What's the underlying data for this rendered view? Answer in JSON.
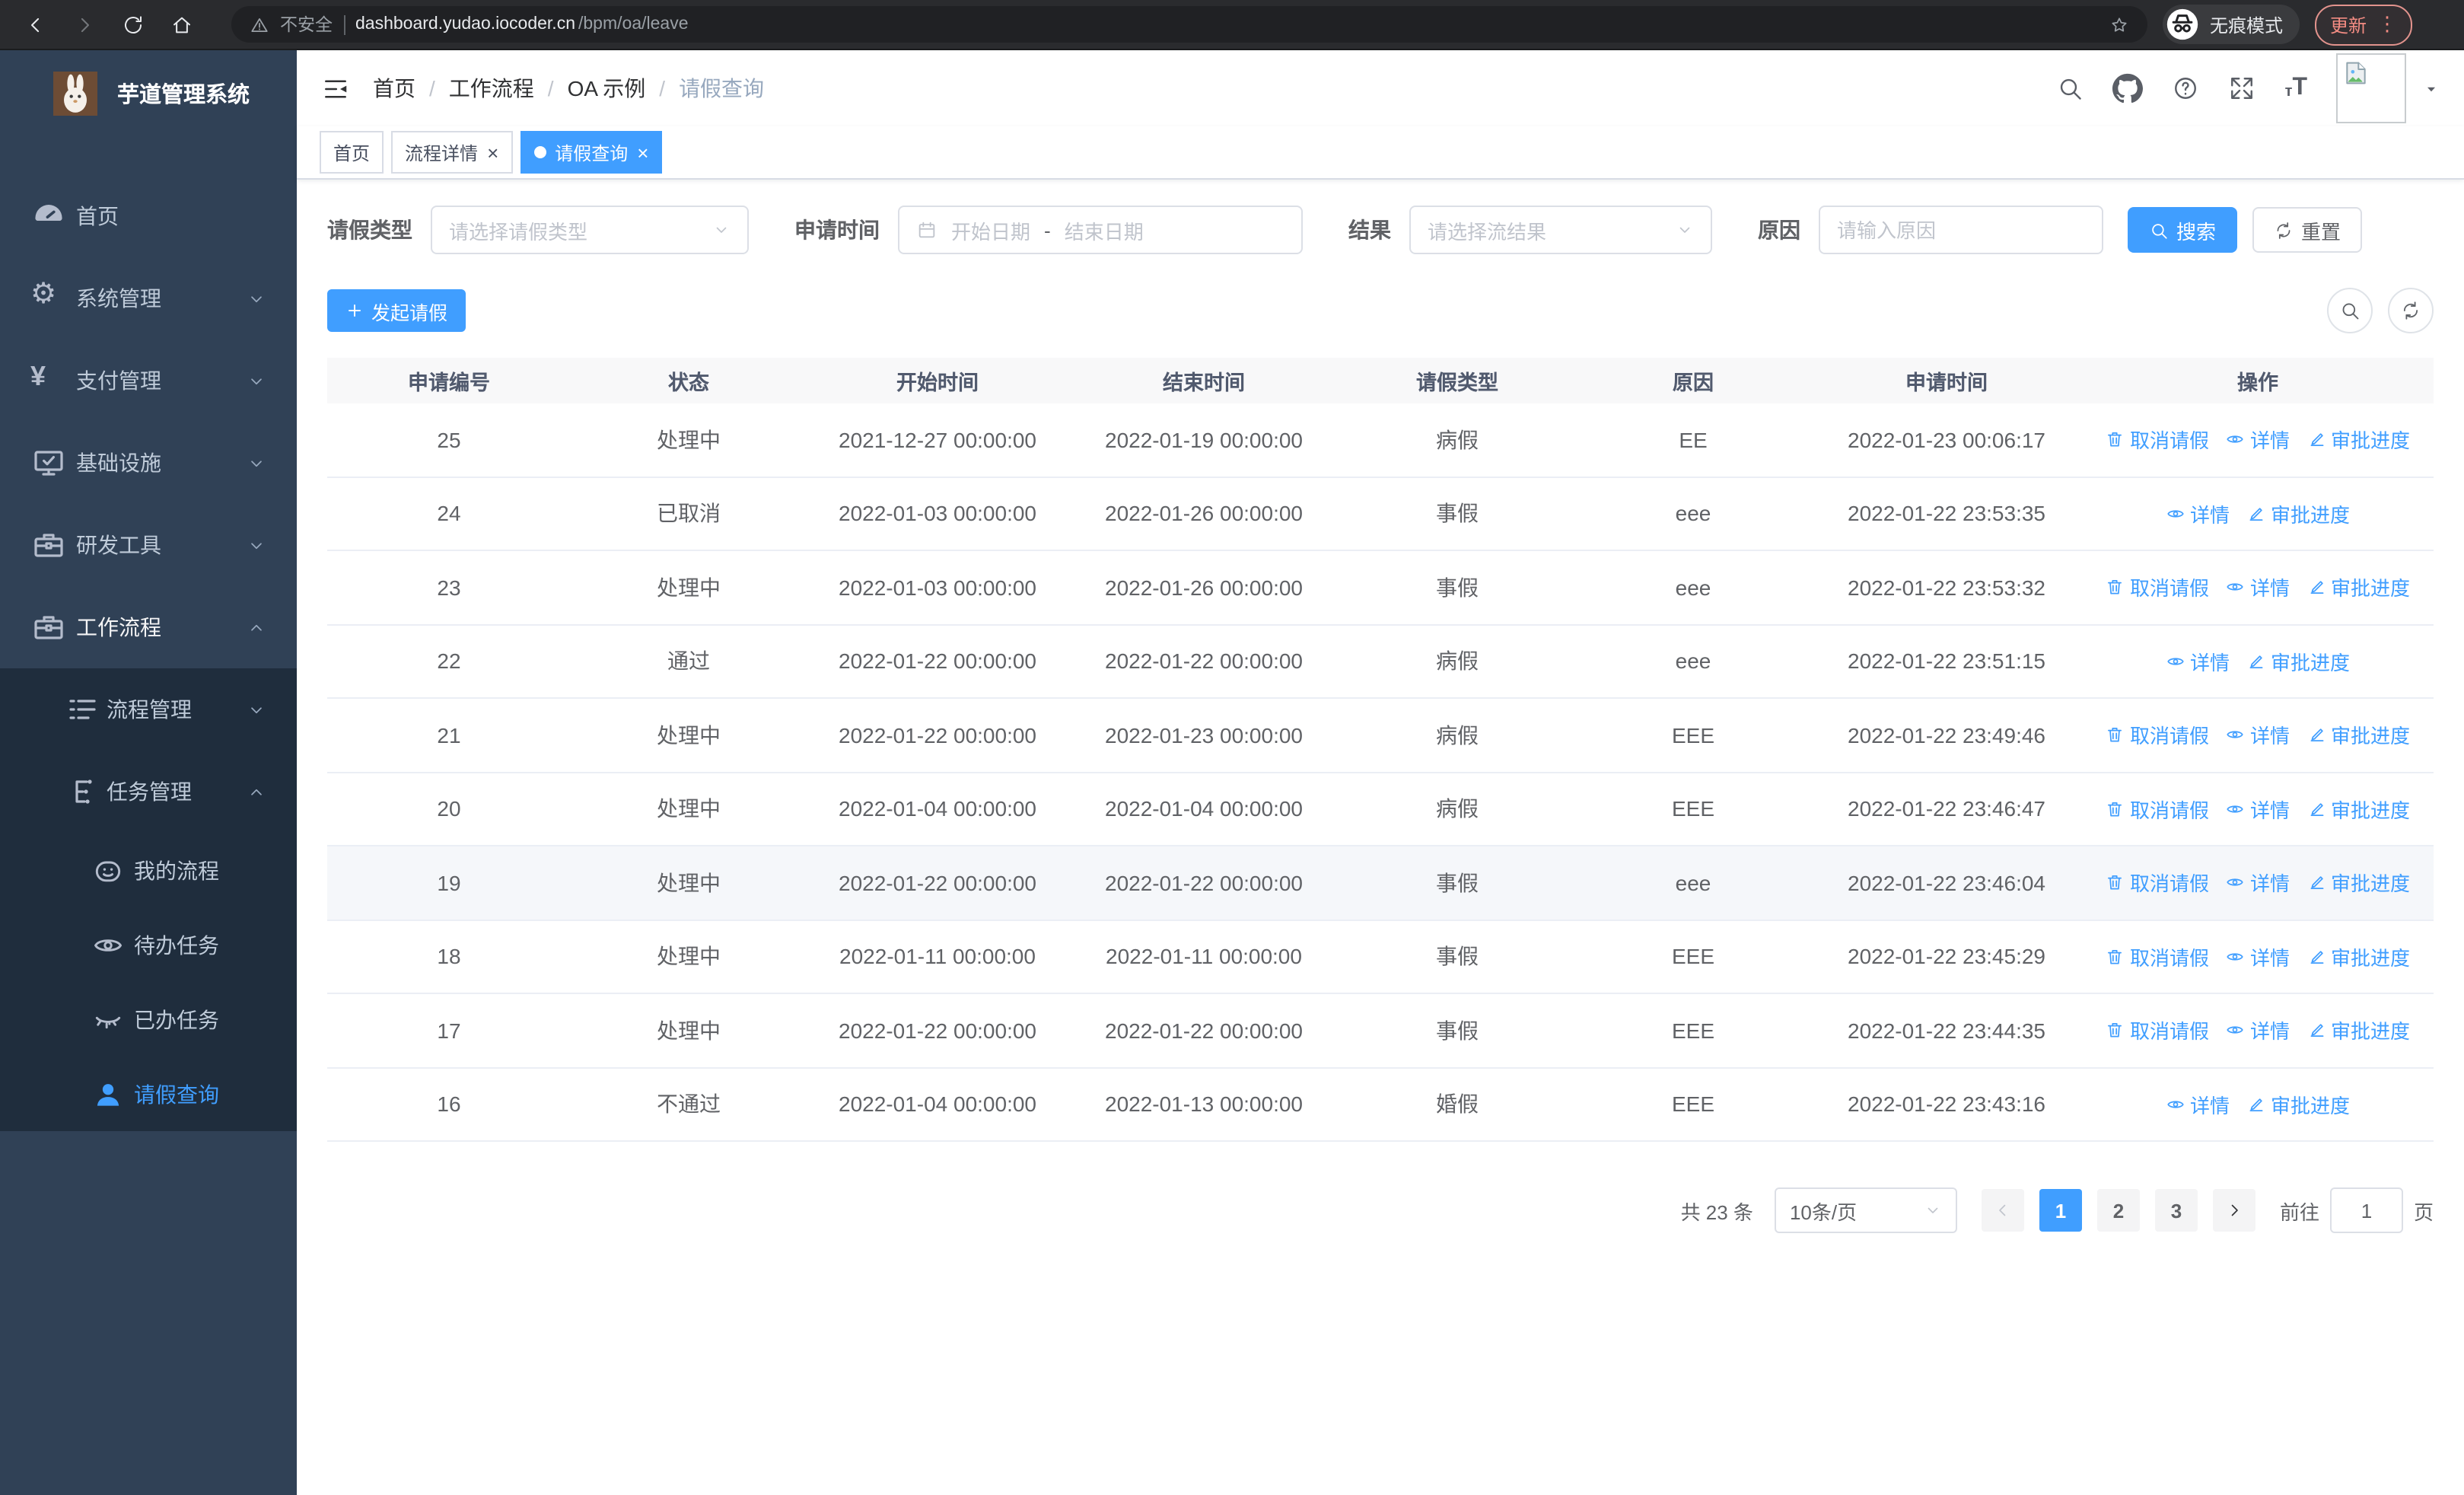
{
  "browser": {
    "security_warning": "不安全",
    "url_host": "dashboard.yudao.iocoder.cn",
    "url_path": "/bpm/oa/leave",
    "incognito_label": "无痕模式",
    "update_button": "更新"
  },
  "sidebar": {
    "app_title": "芋道管理系统",
    "items": [
      {
        "label": "首页",
        "icon": "dashboard-icon"
      },
      {
        "label": "系统管理",
        "icon": "gear-icon"
      },
      {
        "label": "支付管理",
        "icon": "yen-icon"
      },
      {
        "label": "基础设施",
        "icon": "monitor-icon"
      },
      {
        "label": "研发工具",
        "icon": "toolbox-icon"
      },
      {
        "label": "工作流程",
        "icon": "briefcase-icon"
      },
      {
        "label": "流程管理",
        "icon": "list-icon"
      },
      {
        "label": "任务管理",
        "icon": "org-icon"
      },
      {
        "label": "我的流程",
        "icon": "face-icon"
      },
      {
        "label": "待办任务",
        "icon": "eye-icon"
      },
      {
        "label": "已办任务",
        "icon": "eye-closed-icon"
      },
      {
        "label": "请假查询",
        "icon": "user-icon"
      }
    ]
  },
  "breadcrumb": {
    "separator": "/",
    "items": [
      "首页",
      "工作流程",
      "OA 示例",
      "请假查询"
    ]
  },
  "tabs": [
    {
      "label": "首页"
    },
    {
      "label": "流程详情"
    },
    {
      "label": "请假查询"
    }
  ],
  "filters": {
    "leave_type": {
      "label": "请假类型",
      "placeholder": "请选择请假类型"
    },
    "apply_time": {
      "label": "申请时间",
      "start_placeholder": "开始日期",
      "separator": "-",
      "end_placeholder": "结束日期"
    },
    "result": {
      "label": "结果",
      "placeholder": "请选择流结果"
    },
    "reason": {
      "label": "原因",
      "placeholder": "请输入原因"
    },
    "search_button": "搜索",
    "reset_button": "重置"
  },
  "toolbar": {
    "create_button": "发起请假"
  },
  "table": {
    "columns": [
      "申请编号",
      "状态",
      "开始时间",
      "结束时间",
      "请假类型",
      "原因",
      "申请时间",
      "操作"
    ],
    "rows": [
      {
        "id": "25",
        "status": "处理中",
        "start": "2021-12-27 00:00:00",
        "end": "2022-01-19 00:00:00",
        "type": "病假",
        "reason": "EE",
        "apply": "2022-01-23 00:06:17",
        "highlight": false,
        "actions": [
          {
            "label": "取消请假",
            "icon": "delete"
          },
          {
            "label": "详情",
            "icon": "view"
          },
          {
            "label": "审批进度",
            "icon": "edit"
          }
        ]
      },
      {
        "id": "24",
        "status": "已取消",
        "start": "2022-01-03 00:00:00",
        "end": "2022-01-26 00:00:00",
        "type": "事假",
        "reason": "eee",
        "apply": "2022-01-22 23:53:35",
        "highlight": false,
        "actions": [
          {
            "label": "详情",
            "icon": "view"
          },
          {
            "label": "审批进度",
            "icon": "edit"
          }
        ]
      },
      {
        "id": "23",
        "status": "处理中",
        "start": "2022-01-03 00:00:00",
        "end": "2022-01-26 00:00:00",
        "type": "事假",
        "reason": "eee",
        "apply": "2022-01-22 23:53:32",
        "highlight": false,
        "actions": [
          {
            "label": "取消请假",
            "icon": "delete"
          },
          {
            "label": "详情",
            "icon": "view"
          },
          {
            "label": "审批进度",
            "icon": "edit"
          }
        ]
      },
      {
        "id": "22",
        "status": "通过",
        "start": "2022-01-22 00:00:00",
        "end": "2022-01-22 00:00:00",
        "type": "病假",
        "reason": "eee",
        "apply": "2022-01-22 23:51:15",
        "highlight": false,
        "actions": [
          {
            "label": "详情",
            "icon": "view"
          },
          {
            "label": "审批进度",
            "icon": "edit"
          }
        ]
      },
      {
        "id": "21",
        "status": "处理中",
        "start": "2022-01-22 00:00:00",
        "end": "2022-01-23 00:00:00",
        "type": "病假",
        "reason": "EEE",
        "apply": "2022-01-22 23:49:46",
        "highlight": false,
        "actions": [
          {
            "label": "取消请假",
            "icon": "delete"
          },
          {
            "label": "详情",
            "icon": "view"
          },
          {
            "label": "审批进度",
            "icon": "edit"
          }
        ]
      },
      {
        "id": "20",
        "status": "处理中",
        "start": "2022-01-04 00:00:00",
        "end": "2022-01-04 00:00:00",
        "type": "病假",
        "reason": "EEE",
        "apply": "2022-01-22 23:46:47",
        "highlight": false,
        "actions": [
          {
            "label": "取消请假",
            "icon": "delete"
          },
          {
            "label": "详情",
            "icon": "view"
          },
          {
            "label": "审批进度",
            "icon": "edit"
          }
        ]
      },
      {
        "id": "19",
        "status": "处理中",
        "start": "2022-01-22 00:00:00",
        "end": "2022-01-22 00:00:00",
        "type": "事假",
        "reason": "eee",
        "apply": "2022-01-22 23:46:04",
        "highlight": true,
        "actions": [
          {
            "label": "取消请假",
            "icon": "delete"
          },
          {
            "label": "详情",
            "icon": "view"
          },
          {
            "label": "审批进度",
            "icon": "edit"
          }
        ]
      },
      {
        "id": "18",
        "status": "处理中",
        "start": "2022-01-11 00:00:00",
        "end": "2022-01-11 00:00:00",
        "type": "事假",
        "reason": "EEE",
        "apply": "2022-01-22 23:45:29",
        "highlight": false,
        "actions": [
          {
            "label": "取消请假",
            "icon": "delete"
          },
          {
            "label": "详情",
            "icon": "view"
          },
          {
            "label": "审批进度",
            "icon": "edit"
          }
        ]
      },
      {
        "id": "17",
        "status": "处理中",
        "start": "2022-01-22 00:00:00",
        "end": "2022-01-22 00:00:00",
        "type": "事假",
        "reason": "EEE",
        "apply": "2022-01-22 23:44:35",
        "highlight": false,
        "actions": [
          {
            "label": "取消请假",
            "icon": "delete"
          },
          {
            "label": "详情",
            "icon": "view"
          },
          {
            "label": "审批进度",
            "icon": "edit"
          }
        ]
      },
      {
        "id": "16",
        "status": "不通过",
        "start": "2022-01-04 00:00:00",
        "end": "2022-01-13 00:00:00",
        "type": "婚假",
        "reason": "EEE",
        "apply": "2022-01-22 23:43:16",
        "highlight": false,
        "actions": [
          {
            "label": "详情",
            "icon": "view"
          },
          {
            "label": "审批进度",
            "icon": "edit"
          }
        ]
      }
    ]
  },
  "pagination": {
    "total_text": "共 23 条",
    "page_size": "10条/页",
    "pages": [
      "1",
      "2",
      "3"
    ],
    "active_page": "1",
    "goto_label": "前往",
    "goto_value": "1",
    "page_suffix": "页"
  },
  "colors": {
    "accent": "#409eff",
    "sidebar_bg": "#304156",
    "submenu_bg": "#1f2d3d"
  }
}
